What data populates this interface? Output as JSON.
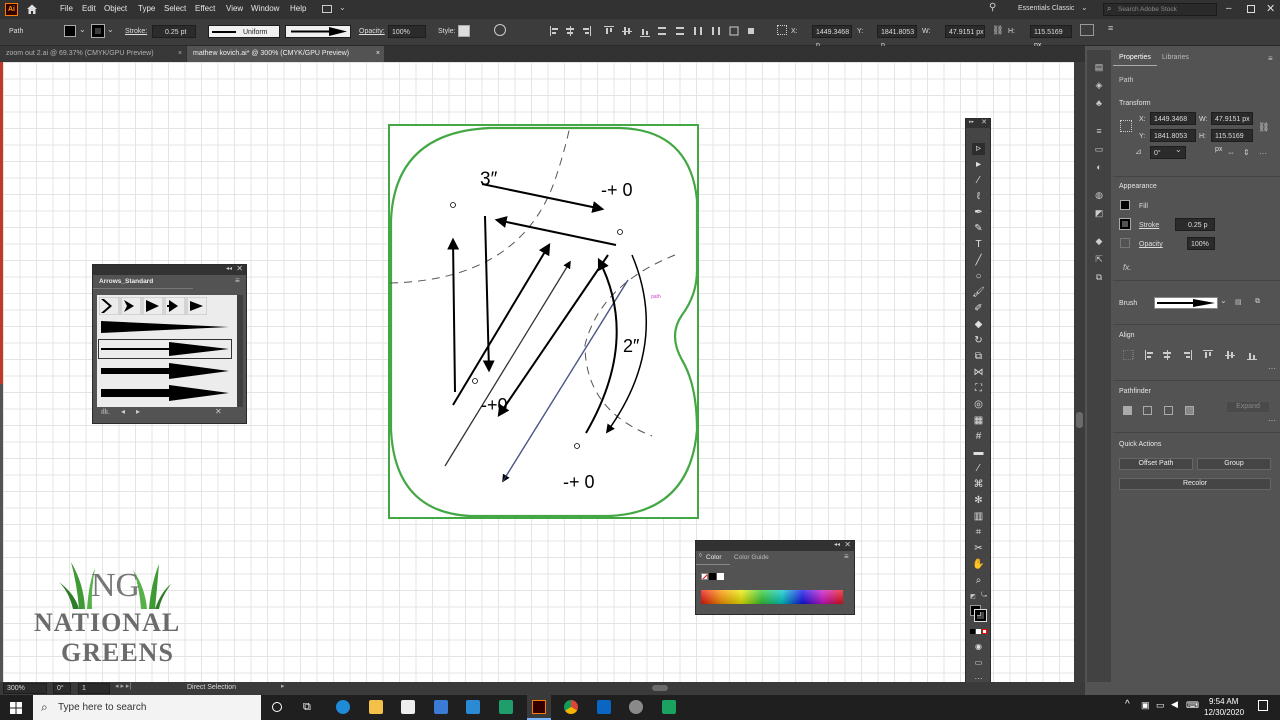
{
  "app": {
    "logo": "Ai",
    "home_icon": "home-icon"
  },
  "menu": [
    "File",
    "Edit",
    "Object",
    "Type",
    "Select",
    "Effect",
    "View",
    "Window",
    "Help"
  ],
  "workspace": "Essentials Classic",
  "search_stock_placeholder": "Search Adobe Stock",
  "control_bar": {
    "object_type": "Path",
    "stroke_label": "Stroke:",
    "stroke_value": "0.25 pt",
    "profile_value": "Uniform",
    "opacity_label": "Opacity:",
    "opacity_value": "100%",
    "style_label": "Style:",
    "x_label": "X:",
    "x_value": "1449.3468 p",
    "y_label": "Y:",
    "y_value": "1841.8053 p",
    "w_label": "W:",
    "w_value": "47.9151 px",
    "h_label": "H:",
    "h_value": "115.5169 px"
  },
  "tabs": [
    {
      "label": "zoom out 2.ai @ 69.37% (CMYK/GPU Preview)",
      "close": "×",
      "active": false
    },
    {
      "label": "mathew kovich.ai* @ 300% (CMYK/GPU Preview)",
      "close": "×",
      "active": true
    }
  ],
  "artboard": {
    "labels": {
      "top_dim": "3″",
      "top_tol": "-+ 0",
      "side_dim": "2″",
      "mid_tol": "-+0",
      "bottom_tol": "-+ 0",
      "path_hint": "path"
    }
  },
  "arrows_panel": {
    "title": "Arrows_Standard",
    "lib_icon": "library-icon"
  },
  "color_panel": {
    "tab_color": "Color",
    "tab_guide": "Color Guide"
  },
  "logo": {
    "line1": "NATIONAL",
    "line2": "GREENS",
    "monogram": "NG"
  },
  "properties": {
    "tab_properties": "Properties",
    "tab_libraries": "Libraries",
    "selection": "Path",
    "transform": "Transform",
    "x_label": "X:",
    "x_value": "1449.3468",
    "y_label": "Y:",
    "y_value": "1841.8053",
    "w_label": "W:",
    "w_value": "47.9151 px",
    "h_label": "H:",
    "h_value": "115.5169 px",
    "rotate_value": "0°",
    "appearance": "Appearance",
    "fill_label": "Fill",
    "stroke_label": "Stroke",
    "stroke_value": "0.25 p",
    "opacity_label": "Opacity",
    "opacity_value": "100%",
    "fx": "fx.",
    "brush_label": "Brush",
    "align": "Align",
    "pathfinder": "Pathfinder",
    "expand": "Expand",
    "quick_actions": "Quick Actions",
    "offset_path": "Offset Path",
    "group": "Group",
    "recolor": "Recolor"
  },
  "status": {
    "zoom": "300%",
    "rotation": "0°",
    "artboard": "1",
    "mode": "Direct Selection"
  },
  "taskbar": {
    "search_placeholder": "Type here to search",
    "time": "9:54 AM",
    "date": "12/30/2020"
  },
  "colors": {
    "artboard_green": "#43a843",
    "ui_dark": "#323232",
    "ui_mid": "#535353",
    "arrow_black": "#000000"
  }
}
